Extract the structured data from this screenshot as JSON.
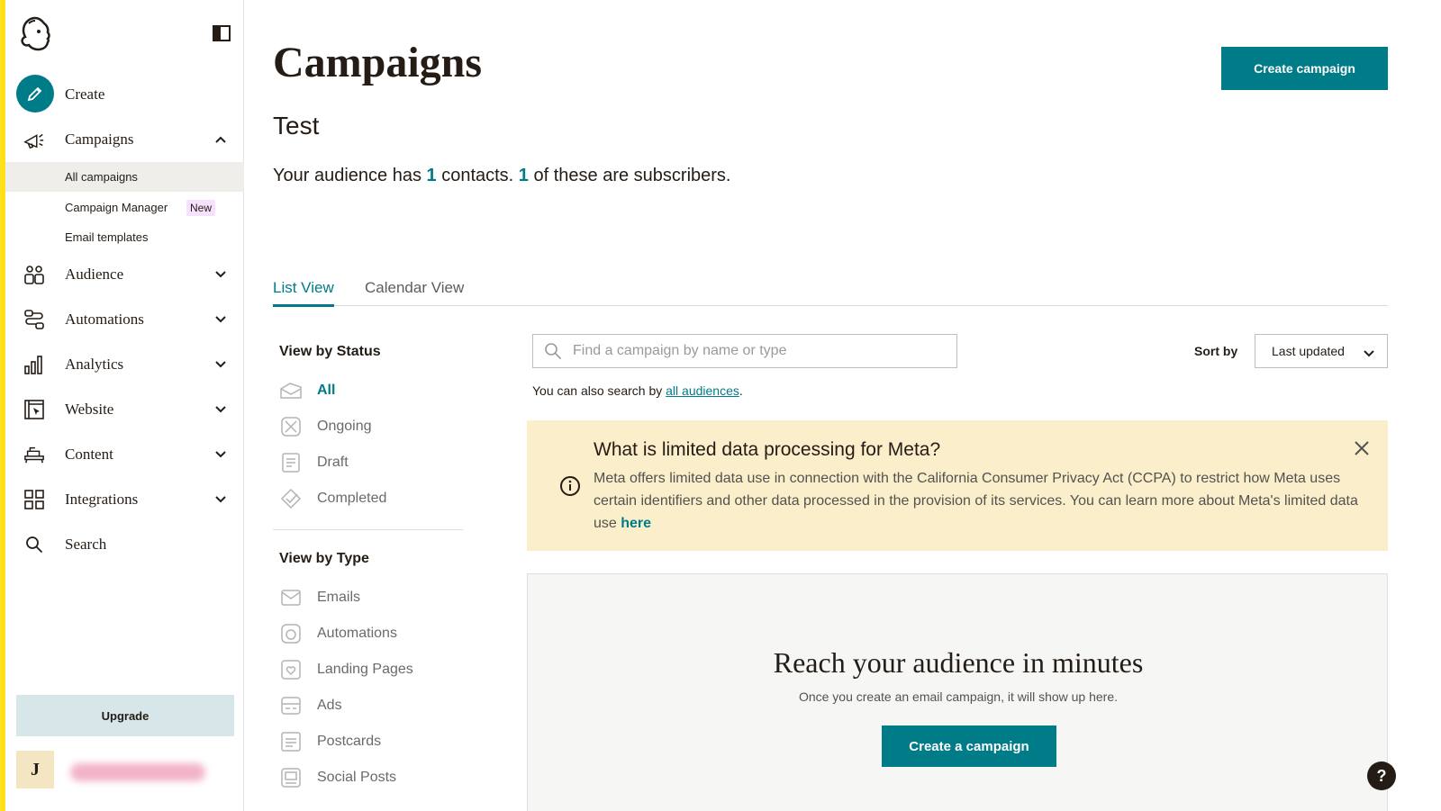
{
  "sidebar": {
    "create_label": "Create",
    "campaigns_label": "Campaigns",
    "sub_items": [
      {
        "label": "All campaigns"
      },
      {
        "label": "Campaign Manager",
        "badge": "New"
      },
      {
        "label": "Email templates"
      }
    ],
    "items": [
      {
        "label": "Audience",
        "icon": "audience-icon"
      },
      {
        "label": "Automations",
        "icon": "automations-icon"
      },
      {
        "label": "Analytics",
        "icon": "analytics-icon"
      },
      {
        "label": "Website",
        "icon": "website-icon"
      },
      {
        "label": "Content",
        "icon": "content-icon"
      },
      {
        "label": "Integrations",
        "icon": "integrations-icon"
      },
      {
        "label": "Search",
        "icon": "search-icon"
      }
    ],
    "upgrade_label": "Upgrade",
    "avatar_initial": "J"
  },
  "header": {
    "title": "Campaigns",
    "create_button": "Create campaign",
    "audience_name": "Test",
    "summary_prefix": "Your audience has ",
    "contacts_count": "1",
    "summary_mid": " contacts. ",
    "subscribers_count": "1",
    "summary_suffix": " of these are subscribers."
  },
  "tabs": [
    {
      "label": "List View",
      "active": true
    },
    {
      "label": "Calendar View",
      "active": false
    }
  ],
  "filters": {
    "status_heading": "View by Status",
    "status": [
      "All",
      "Ongoing",
      "Draft",
      "Completed"
    ],
    "type_heading": "View by Type",
    "type": [
      "Emails",
      "Automations",
      "Landing Pages",
      "Ads",
      "Postcards",
      "Social Posts"
    ]
  },
  "search": {
    "placeholder": "Find a campaign by name or type",
    "hint_prefix": "You can also search by ",
    "hint_link": "all audiences",
    "hint_suffix": "."
  },
  "sort": {
    "label": "Sort by",
    "value": "Last updated"
  },
  "banner": {
    "title": "What is limited data processing for Meta?",
    "body": "Meta offers limited data use in connection with the California Consumer Privacy Act (CCPA) to restrict how Meta uses certain identifiers and other data processed in the provision of its services. You can learn more about Meta's limited data use ",
    "link": "here"
  },
  "empty_state": {
    "title": "Reach your audience in minutes",
    "subtitle": "Once you create an email campaign, it will show up here.",
    "button": "Create a campaign"
  },
  "help_label": "?",
  "colors": {
    "accent": "#007c89",
    "banner_bg": "#fbeecb",
    "yellow_edge": "#ffe01b"
  }
}
